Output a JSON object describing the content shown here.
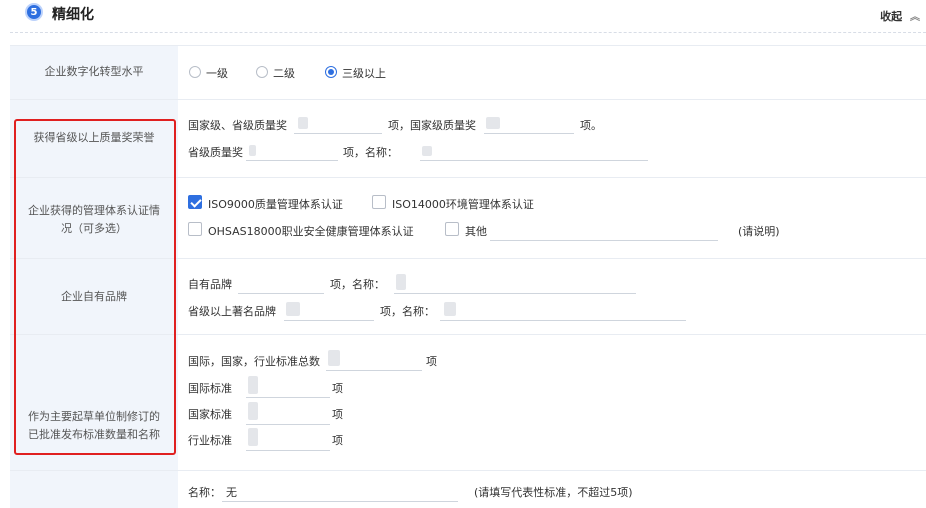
{
  "section": {
    "number": "5",
    "title": "精细化",
    "collapse_label": "收起",
    "collapse_icon": "double-chevron-up-icon"
  },
  "rows": {
    "digital": {
      "label": "企业数字化转型水平",
      "options": [
        {
          "label": "一级",
          "selected": false
        },
        {
          "label": "二级",
          "selected": false
        },
        {
          "label": "三级以上",
          "selected": true
        }
      ]
    },
    "quality_award": {
      "label": "获得省级以上质量奖荣誉",
      "line1_prefix": "国家级、省级质量奖",
      "line1_mid": "项，国家级质量奖",
      "line1_suffix": "项。",
      "line2_prefix": "省级质量奖",
      "line2_mid": "项，名称："
    },
    "cert": {
      "label_line1": "企业获得的管理体系认证情",
      "label_line2": "况（可多选）",
      "options": [
        {
          "label": "ISO9000质量管理体系认证",
          "checked": true
        },
        {
          "label": "ISO14000环境管理体系认证",
          "checked": false
        },
        {
          "label": "OHSAS18000职业安全健康管理体系认证",
          "checked": false
        },
        {
          "label": "其他",
          "checked": false
        }
      ],
      "other_note": "(请说明)"
    },
    "brand": {
      "label": "企业自有品牌",
      "line1_prefix": "自有品牌",
      "line1_mid": "项，名称：",
      "line2_prefix": "省级以上著名品牌",
      "line2_mid": "项，名称："
    },
    "standards": {
      "label_line1": "作为主要起草单位制修订的",
      "label_line2": "已批准发布标准数量和名称",
      "total_prefix": "国际，国家，行业标准总数",
      "unit": "项",
      "intl": "国际标准",
      "national": "国家标准",
      "industry": "行业标准",
      "name_label": "名称：",
      "name_value": "无",
      "name_hint": "(请填写代表性标准，不超过5项)"
    }
  },
  "colors": {
    "accent": "#2e6fe0",
    "highlight_box": "#e02020",
    "label_bg": "#f1f5fb"
  }
}
